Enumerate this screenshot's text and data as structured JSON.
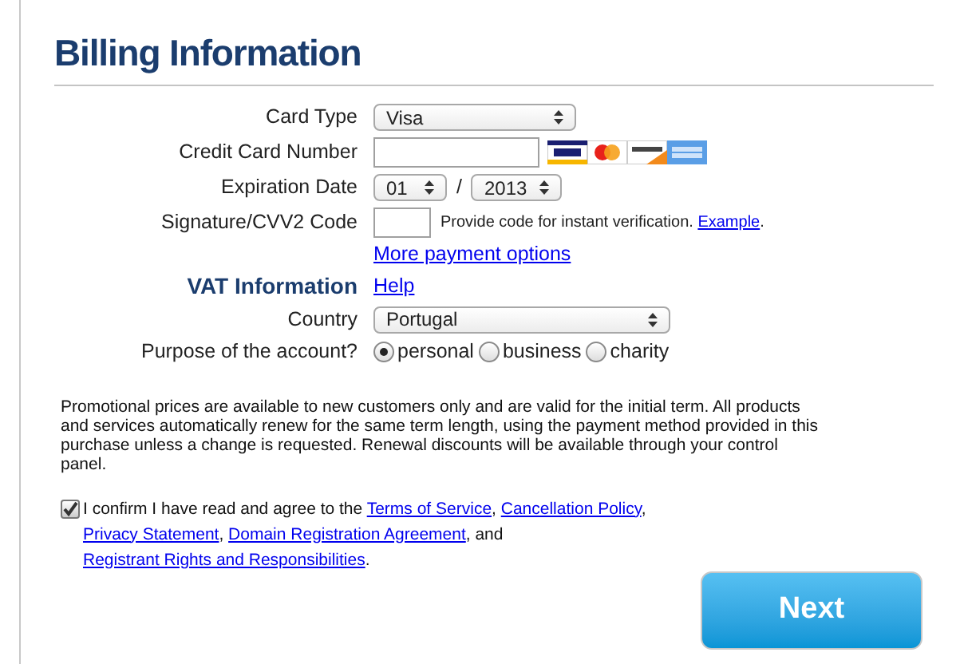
{
  "title": "Billing Information",
  "card_type": {
    "label": "Card Type",
    "value": "Visa"
  },
  "card_number": {
    "label": "Credit Card Number"
  },
  "expiration": {
    "label": "Expiration Date",
    "month": "01",
    "separator": "/",
    "year": "2013"
  },
  "cvv": {
    "label": "Signature/CVV2 Code",
    "hint": "Provide code for instant verification.",
    "link": "Example",
    "after": "."
  },
  "more_link": "More payment options",
  "vat": {
    "heading": "VAT Information",
    "help": "Help"
  },
  "country": {
    "label": "Country",
    "value": "Portugal"
  },
  "purpose": {
    "label": "Purpose of the account?",
    "options": [
      {
        "label": "personal",
        "selected": true
      },
      {
        "label": "business",
        "selected": false
      },
      {
        "label": "charity",
        "selected": false
      }
    ]
  },
  "notice": "Promotional prices are available to new customers only and are valid for the initial term. All products and services automatically renew for the same term length, using the payment method provided in this purchase unless a change is requested. Renewal discounts will be available through your control panel.",
  "confirm": {
    "checked": true,
    "parts": [
      {
        "kind": "text",
        "text": "I confirm I have read and agree to the"
      },
      {
        "kind": "link",
        "text": "Terms of Service"
      },
      {
        "kind": "text",
        "text": ","
      },
      {
        "kind": "link",
        "text": "Cancellation Policy"
      },
      {
        "kind": "text",
        "text": ","
      },
      {
        "kind": "link",
        "text": "Privacy Statement"
      },
      {
        "kind": "text",
        "text": ","
      },
      {
        "kind": "link",
        "text": "Domain Registration Agreement"
      },
      {
        "kind": "text",
        "text": ", and"
      },
      {
        "kind": "link",
        "text": "Registrant Rights and Responsibilities"
      },
      {
        "kind": "text",
        "text": "."
      }
    ]
  },
  "next_button": "Next"
}
